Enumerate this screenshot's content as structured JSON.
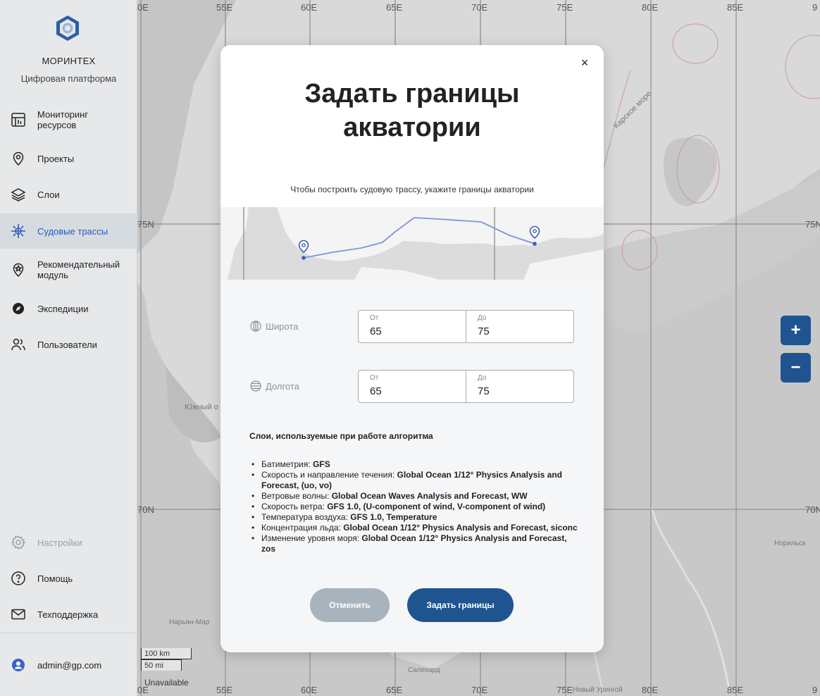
{
  "sidebar": {
    "brand_name": "МОРИНТЕХ",
    "brand_sub": "Цифровая платформа",
    "items": [
      {
        "label": "Мониторинг ресурсов",
        "icon": "monitoring-icon"
      },
      {
        "label": "Проекты",
        "icon": "map-pin-icon"
      },
      {
        "label": "Слои",
        "icon": "layers-icon"
      },
      {
        "label": "Судовые трассы",
        "icon": "ship-route-icon",
        "active": true
      },
      {
        "label": "Рекомендательный модуль",
        "icon": "recommend-icon"
      },
      {
        "label": "Экспедиции",
        "icon": "compass-icon"
      },
      {
        "label": "Пользователи",
        "icon": "users-icon"
      }
    ],
    "bottom_items": [
      {
        "label": "Настройки",
        "icon": "gear-icon",
        "disabled": true
      },
      {
        "label": "Помощь",
        "icon": "help-icon"
      },
      {
        "label": "Техподдержка",
        "icon": "mail-icon"
      }
    ],
    "user": "admin@gp.com"
  },
  "map": {
    "lon_labels": [
      "0E",
      "55E",
      "60E",
      "65E",
      "70E",
      "75E",
      "80E",
      "85E",
      "9"
    ],
    "lat_labels": {
      "n75_left": "75N",
      "n75_right": "75N",
      "n70_left": "70N",
      "n70_right": "70N"
    },
    "place_labels": {
      "kara_sea": "Карское море",
      "yuzhny": "Южный о",
      "naryan_mar": "Нарьян-Мар",
      "norilsk": "Норильск",
      "salekhard": "Салехард",
      "urengoy": "Новый Уренгой"
    },
    "zoom_in": "+",
    "zoom_out": "−",
    "scale_km": "100 km",
    "scale_mi": "50 mi",
    "status": "Unavailable"
  },
  "modal": {
    "close": "×",
    "title": "Задать границы акватории",
    "subtitle": "Чтобы построить судовую трассу, укажите границы акватории",
    "latitude": {
      "label": "Широта",
      "from_caption": "От",
      "from_value": "65",
      "to_caption": "До",
      "to_value": "75"
    },
    "longitude": {
      "label": "Долгота",
      "from_caption": "От",
      "from_value": "65",
      "to_caption": "До",
      "to_value": "75"
    },
    "layers_title": "Слои, используемые при работе алгоритма",
    "layers": [
      {
        "name": "Батиметрия: ",
        "value": "GFS"
      },
      {
        "name": "Скорость и направление течения: ",
        "value": "Global Ocean 1/12° Physics Analysis and Forecast, (uo, vo)"
      },
      {
        "name": "Ветровые волны: ",
        "value": "Global Ocean Waves Analysis and Forecast, WW"
      },
      {
        "name": "Скорость ветра: ",
        "value": "GFS 1.0, (U-component of wind, V-component of wind)"
      },
      {
        "name": "Температура воздуха: ",
        "value": "GFS 1.0, Temperature"
      },
      {
        "name": "Концентрация льда: ",
        "value": "Global Ocean 1/12° Physics Analysis and Forecast, siconc"
      },
      {
        "name": "Изменение уровня моря: ",
        "value": "Global Ocean 1/12° Physics Analysis and Forecast, zos"
      }
    ],
    "cancel_label": "Отменить",
    "submit_label": "Задать границы"
  },
  "colors": {
    "accent": "#1f5491",
    "active_nav": "#2a5bb5",
    "cancel": "#a9b3bd"
  }
}
